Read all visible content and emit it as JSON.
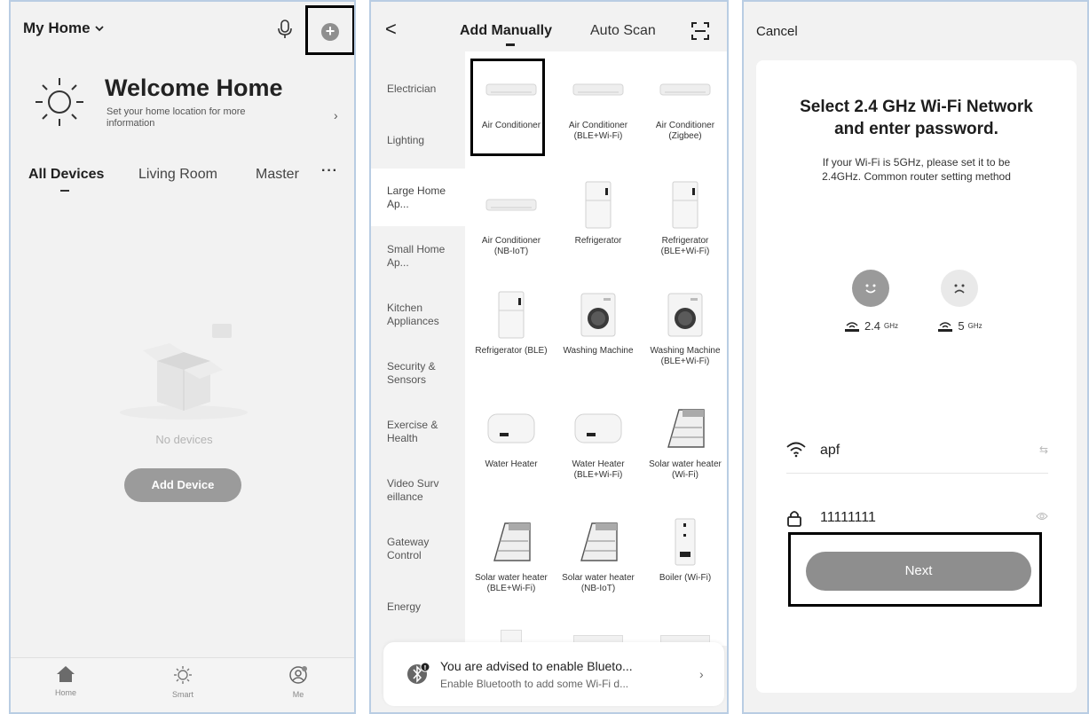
{
  "panel1": {
    "home_selector": "My Home",
    "welcome_title": "Welcome Home",
    "welcome_subtitle": "Set your home location for more information",
    "room_tabs": [
      "All Devices",
      "Living Room",
      "Master"
    ],
    "more_glyph": "···",
    "empty_text": "No devices",
    "add_device_label": "Add Device",
    "bottom_nav": [
      "Home",
      "Smart",
      "Me"
    ],
    "icons": [
      "chevron-down-icon",
      "microphone-icon",
      "add-circle-icon",
      "sun-icon",
      "chevron-right-icon",
      "empty-box-icon",
      "home-icon",
      "smart-icon",
      "profile-icon"
    ]
  },
  "panel2": {
    "back_glyph": "<",
    "tabs": [
      "Add Manually",
      "Auto Scan"
    ],
    "categories": [
      "Electrician",
      "Lighting",
      "Large Home Ap...",
      "Small Home Ap...",
      "Kitchen Appliances",
      "Security & Sensors",
      "Exercise & Health",
      "Video Surv eillance",
      "Gateway Control",
      "Energy"
    ],
    "active_category": "Large Home Ap...",
    "devices": [
      {
        "name": "Air Conditioner",
        "icon": "air-conditioner-icon"
      },
      {
        "name": "Air Conditioner (BLE+Wi-Fi)",
        "icon": "air-conditioner-icon"
      },
      {
        "name": "Air Conditioner (Zigbee)",
        "icon": "air-conditioner-icon"
      },
      {
        "name": "Air Conditioner (NB-IoT)",
        "icon": "air-conditioner-icon"
      },
      {
        "name": "Refrigerator",
        "icon": "refrigerator-icon"
      },
      {
        "name": "Refrigerator (BLE+Wi-Fi)",
        "icon": "refrigerator-icon"
      },
      {
        "name": "Refrigerator (BLE)",
        "icon": "refrigerator-icon"
      },
      {
        "name": "Washing Machine",
        "icon": "washing-machine-icon"
      },
      {
        "name": "Washing Machine (BLE+Wi-Fi)",
        "icon": "washing-machine-icon"
      },
      {
        "name": "Water Heater",
        "icon": "water-heater-icon"
      },
      {
        "name": "Water Heater (BLE+Wi-Fi)",
        "icon": "water-heater-icon"
      },
      {
        "name": "Solar water heater (Wi-Fi)",
        "icon": "solar-water-heater-icon"
      },
      {
        "name": "Solar water heater (BLE+Wi-Fi)",
        "icon": "solar-water-heater-icon"
      },
      {
        "name": "Solar water heater (NB-IoT)",
        "icon": "solar-water-heater-icon"
      },
      {
        "name": "Boiler (Wi-Fi)",
        "icon": "boiler-icon"
      }
    ],
    "bluetooth_banner": {
      "title": "You are advised to enable Blueto...",
      "subtitle": "Enable Bluetooth to add some Wi-Fi d..."
    }
  },
  "panel3": {
    "cancel_label": "Cancel",
    "title": "Select 2.4 GHz Wi-Fi Network and enter password.",
    "subtitle": "If your Wi-Fi is 5GHz, please set it to be 2.4GHz. Common router setting method",
    "band_good": "2.4",
    "band_good_unit": "GHz",
    "band_bad": "5",
    "band_bad_unit": "GHz",
    "wifi_name": "apf",
    "password": "11111111",
    "next_label": "Next"
  }
}
